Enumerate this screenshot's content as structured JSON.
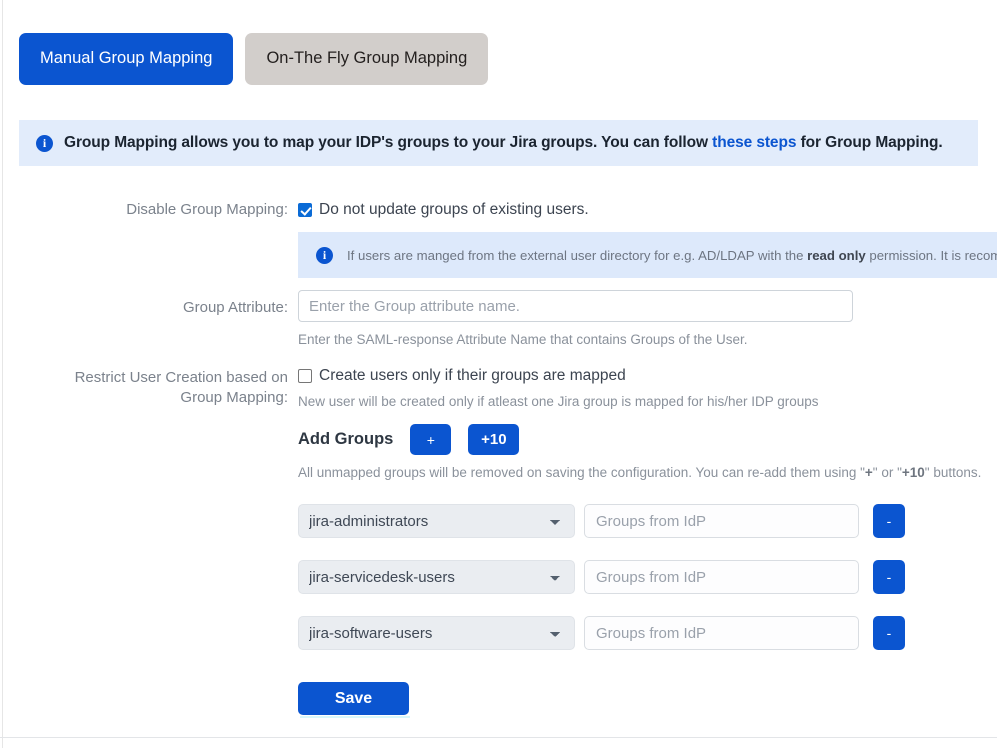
{
  "tabs": [
    {
      "label": "Manual Group Mapping",
      "active": true
    },
    {
      "label": "On-The Fly Group Mapping",
      "active": false
    }
  ],
  "info_banner": {
    "icon": "info-circle-icon",
    "text_before": "Group Mapping allows you to map your IDP's groups to your Jira groups. You can follow ",
    "link_text": "these steps",
    "text_after": " for Group Mapping."
  },
  "disable_group_mapping": {
    "label": "Disable Group Mapping:",
    "checkbox_label": "Do not update groups of existing users.",
    "checked": true,
    "nested_info": {
      "icon": "info-circle-icon",
      "text_before": "If users are manged from the external user directory for e.g. AD/LDAP with the ",
      "bold_text": "read only",
      "text_after": " permission. It is recommended t"
    }
  },
  "group_attribute": {
    "label": "Group Attribute:",
    "placeholder": "Enter the Group attribute name.",
    "value": "",
    "help": "Enter the SAML-response Attribute Name that contains Groups of the User."
  },
  "restrict_user_creation": {
    "label_line1": "Restrict User Creation based on",
    "label_line2": "Group Mapping:",
    "checkbox_label": "Create users only if their groups are mapped",
    "checked": false,
    "help": "New user will be created only if atleast one Jira group is mapped for his/her IDP groups"
  },
  "add_groups": {
    "label": "Add Groups",
    "plus_label": "+",
    "plus_ten_label": "+10",
    "help_before": "All unmapped groups will be removed on saving the configuration. You can re-add them using \"",
    "help_bold_1": "+",
    "help_mid": "\" or \"",
    "help_bold_2": "+10",
    "help_after": "\" buttons."
  },
  "mapping_rows": [
    {
      "jira_group": "jira-administrators",
      "idp_placeholder": "Groups from IdP",
      "idp_value": "",
      "remove_label": "-"
    },
    {
      "jira_group": "jira-servicedesk-users",
      "idp_placeholder": "Groups from IdP",
      "idp_value": "",
      "remove_label": "-"
    },
    {
      "jira_group": "jira-software-users",
      "idp_placeholder": "Groups from IdP",
      "idp_value": "",
      "remove_label": "-"
    }
  ],
  "save_button": {
    "label": "Save"
  },
  "colors": {
    "primary_blue": "#0b55d0",
    "inactive_tab_gray": "#d2cecb",
    "banner_bg": "#e2ecfb",
    "nested_banner_bg": "#dde9fb",
    "label_gray": "#7b828c",
    "help_gray": "#8a919b"
  }
}
